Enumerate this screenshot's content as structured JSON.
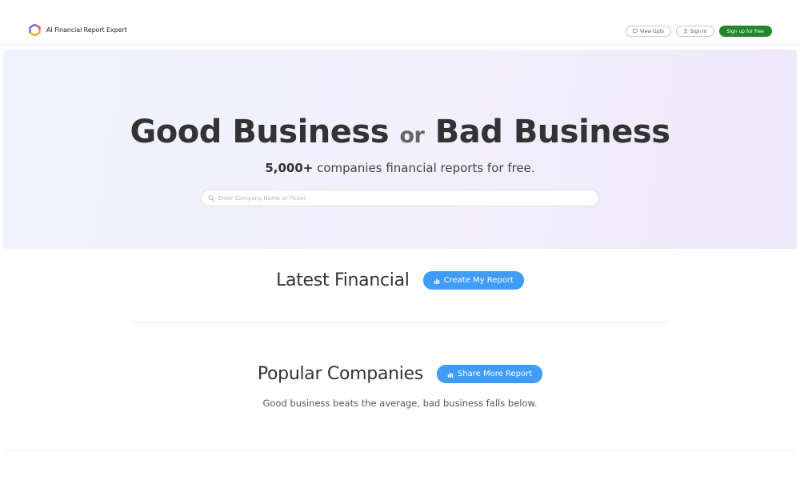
{
  "header": {
    "brand_name": "AI Financial Report Expert",
    "logo_icon": "hexagon-logo-icon",
    "nav": {
      "view_gpts": "View Gpts",
      "sign_in": "Sign In",
      "sign_up": "Sign up for free"
    }
  },
  "hero": {
    "title_left": "Good Business",
    "title_or": "or",
    "title_right": "Bad Business",
    "subtitle_bold": "5,000+",
    "subtitle_rest": " companies financial reports for free.",
    "search_placeholder": "Enter Company Name or Ticker"
  },
  "latest": {
    "title": "Latest Financial",
    "button_label": "Create My Report"
  },
  "popular": {
    "title": "Popular Companies",
    "button_label": "Share More Report",
    "subtitle": "Good business beats the average, bad business falls below."
  },
  "colors": {
    "accent_green": "#22862c",
    "accent_blue": "#3f9cf7",
    "hero_bg": "#f1f0fc"
  }
}
